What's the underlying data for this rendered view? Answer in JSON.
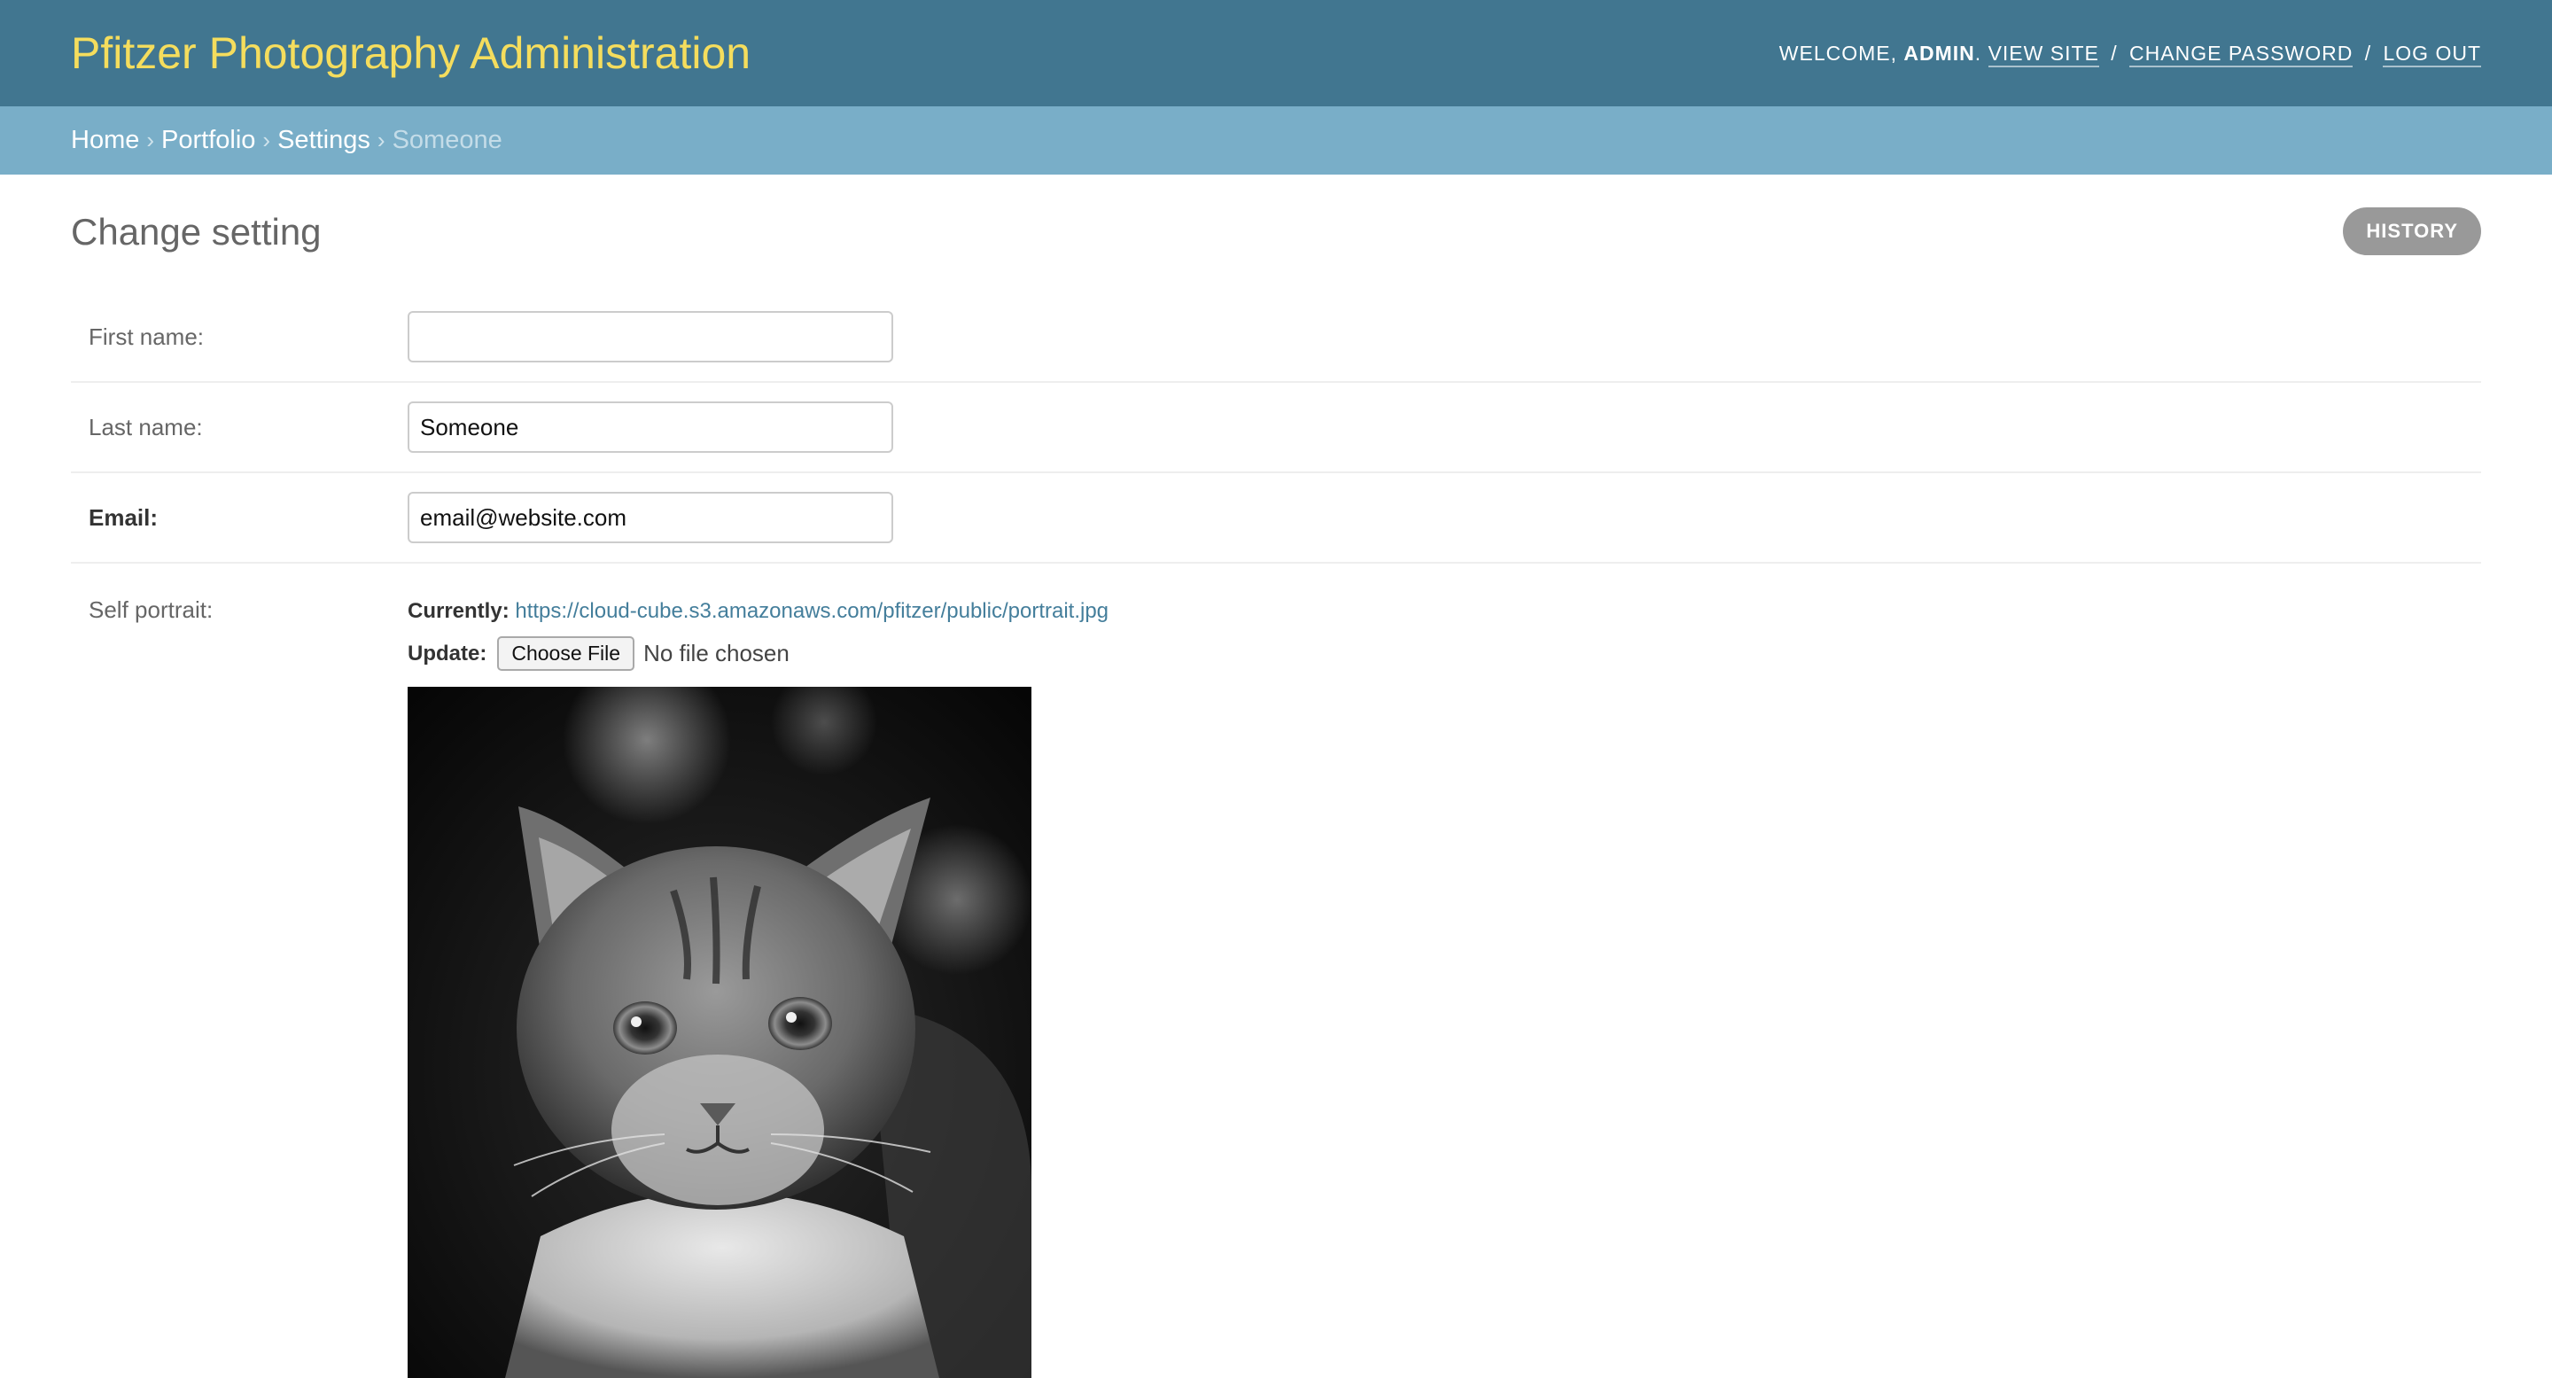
{
  "header": {
    "title": "Pfitzer Photography Administration",
    "welcome": "Welcome,",
    "username": "admin",
    "period": ".",
    "view_site": "View site",
    "change_password": "Change password",
    "log_out": "Log out",
    "separator": "/"
  },
  "breadcrumbs": {
    "home": "Home",
    "portfolio": "Portfolio",
    "settings": "Settings",
    "current": "Someone",
    "arrow": "›"
  },
  "page": {
    "title": "Change setting",
    "history_button": "History"
  },
  "form": {
    "first_name": {
      "label": "First name:",
      "value": ""
    },
    "last_name": {
      "label": "Last name:",
      "value": "Someone"
    },
    "email": {
      "label": "Email:",
      "value": "email@website.com"
    },
    "self_portrait": {
      "label": "Self portrait:",
      "currently_label": "Currently:",
      "currently_link": "https://cloud-cube.s3.amazonaws.com/pfitzer/public/portrait.jpg",
      "update_label": "Update:",
      "choose_button": "Choose File",
      "no_file": "No file chosen"
    }
  },
  "colors": {
    "header_bg": "#417690",
    "branding": "#f5dd5d",
    "breadcrumbs_bg": "#79aec8",
    "link": "#447e9b",
    "history_bg": "#999999"
  }
}
